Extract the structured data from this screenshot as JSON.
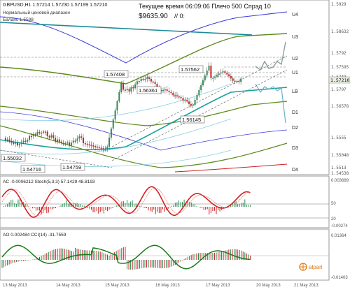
{
  "header": {
    "symbol_line": "GBPUSD,H1  1.57214 1.57230 1.57199 1.57210",
    "timer_line": "Текущее время 06:09:06 Плечо 500 Спрэд 10",
    "note_line1": "Нормальный ценовой диапазон",
    "note_line2": "Баланс 1.5598",
    "balance": "$9635.90",
    "balance_tag": "// 0:"
  },
  "levels": [
    {
      "label": "U4",
      "price": "1.5929"
    },
    {
      "label": "U3",
      "price": "1.5863"
    },
    {
      "label": "U2",
      "price": "1.5792"
    },
    {
      "label": "U1",
      "price": "1.5749"
    },
    {
      "label": "LB",
      "price": "1.5707"
    },
    {
      "label": "D1",
      "price": "1.5658"
    },
    {
      "label": "D2",
      "price": "1.5608"
    },
    {
      "label": "D3",
      "price": "1.5555"
    },
    {
      "label": "D4",
      "price": "1.5513"
    }
  ],
  "price_axis": [
    "1.5929",
    "1.58632",
    "1.5792",
    "1.57595",
    "1.5749",
    "1.5710",
    "1.5707",
    "1.56578",
    "1.5555",
    "1.55048",
    "1.5513",
    "1.54538"
  ],
  "current_price": "1.57210",
  "annotations": [
    "1.57408",
    "1.57562",
    "1.56361",
    "1.56145",
    "1.55032",
    "1.54716",
    "1.54759"
  ],
  "ac_indicator": {
    "label": "AC -0.0006212  Stoch(5,3,3) 57.1429 48.8193",
    "scale": [
      "0.003689",
      "50",
      "20",
      "-0.00274"
    ]
  },
  "ao_indicator": {
    "label": "AO 0.002484  CCI(14) -31.7559",
    "scale": [
      "0.01364",
      "-0.01403"
    ]
  },
  "brand": "alpari",
  "time_axis": [
    "13 May 2013",
    "14 May 2013",
    "15 May 2013",
    "16 May 2013",
    "17 May 2013",
    "20 May 2013",
    "21 May 2013"
  ],
  "colors": {
    "up_candle": "#2e8b57",
    "down_candle": "#cc2222",
    "band_outer": "#3a3ad8",
    "band_green": "#5a8a1a",
    "band_teal": "#1aa0a0",
    "stoch": "#d62020",
    "cci": "#1a7a1a"
  }
}
